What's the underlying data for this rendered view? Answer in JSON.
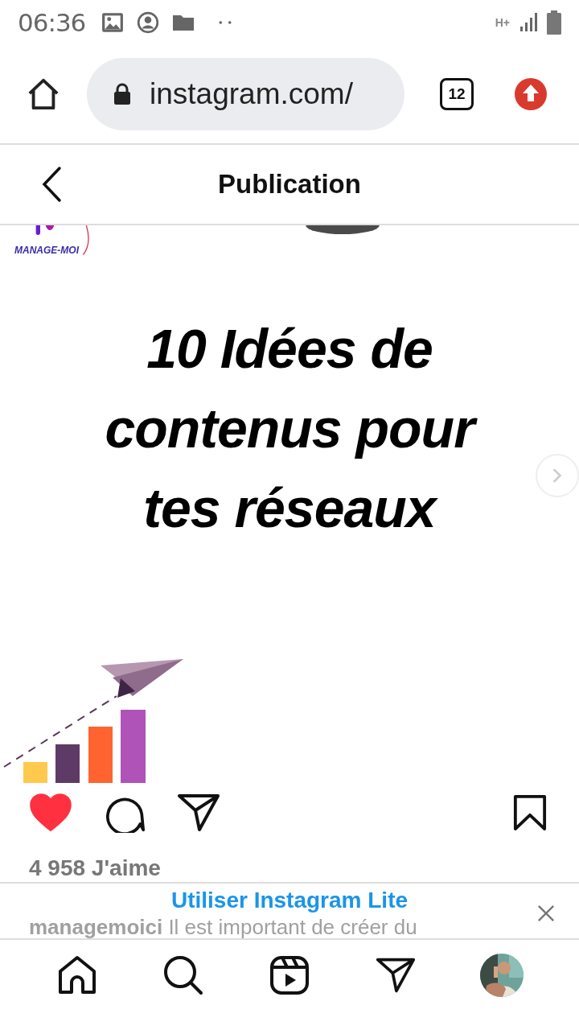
{
  "status_bar": {
    "time": "06:36",
    "network": "H+"
  },
  "browser": {
    "url": "instagram.com/",
    "tab_count": "12"
  },
  "header": {
    "title": "Publication"
  },
  "post": {
    "logo_text": "MANAGE-MOI",
    "title_lines": [
      "10 Idées de",
      "contenus pour",
      "tes réseaux"
    ],
    "liked": true,
    "saved": false,
    "likes": "4 958 J'aime",
    "caption_user": "managemoici",
    "caption_text": "Il est important de créer du"
  },
  "banner": {
    "text": "Utiliser Instagram Lite"
  },
  "bottom_nav": [
    {
      "kind": "home"
    },
    {
      "kind": "search"
    },
    {
      "kind": "reels"
    },
    {
      "kind": "direct"
    },
    {
      "kind": "profile"
    }
  ]
}
